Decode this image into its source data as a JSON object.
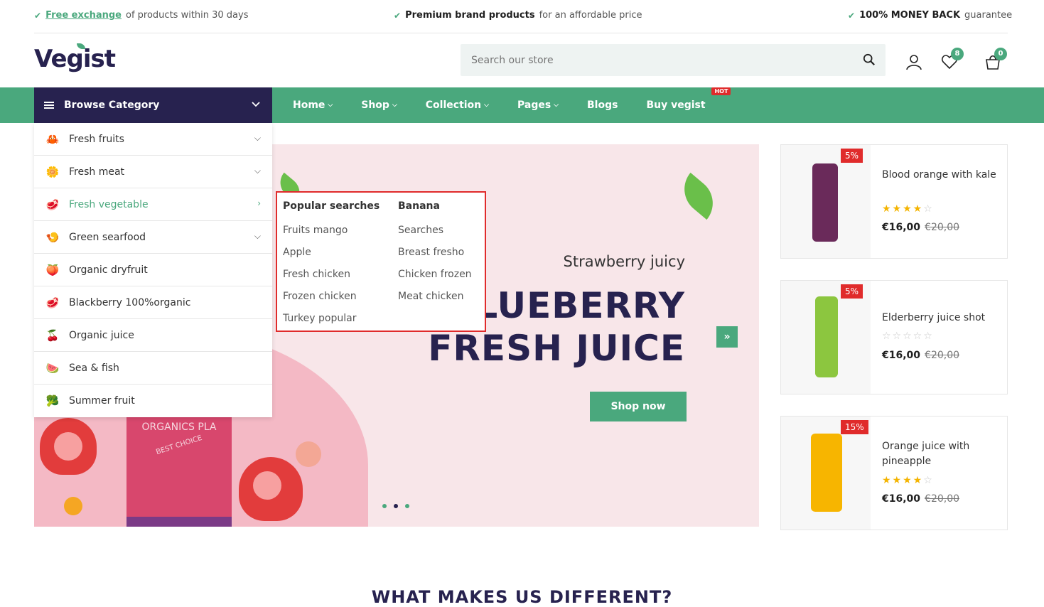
{
  "topbar": {
    "item1_link": "Free exchange",
    "item1_text": "of products within 30 days",
    "item2_bold": "Premium brand products",
    "item2_text": "for an affordable price",
    "item3_bold": "100% MONEY BACK",
    "item3_text": "guarantee",
    "check_icon": "check-icon"
  },
  "header": {
    "logo": "Vegist",
    "search_placeholder": "Search our store",
    "wishlist_count": "8",
    "cart_count": "0"
  },
  "nav": {
    "browse_label": "Browse Category",
    "items": [
      {
        "label": "Home",
        "dropdown": true
      },
      {
        "label": "Shop",
        "dropdown": true
      },
      {
        "label": "Collection",
        "dropdown": true
      },
      {
        "label": "Pages",
        "dropdown": true
      },
      {
        "label": "Blogs",
        "dropdown": false
      },
      {
        "label": "Buy vegist",
        "dropdown": false
      }
    ],
    "hot_badge": "HOT",
    "accent": "#4aa87d",
    "dark": "#27224f"
  },
  "categories": [
    {
      "label": "Fresh fruits",
      "arrow": "down"
    },
    {
      "label": "Fresh meat",
      "arrow": "down"
    },
    {
      "label": "Fresh vegetable",
      "arrow": "right"
    },
    {
      "label": "Green searfood",
      "arrow": "down"
    },
    {
      "label": "Organic dryfruit",
      "arrow": ""
    },
    {
      "label": "Blackberry 100%organic",
      "arrow": ""
    },
    {
      "label": "Organic juice",
      "arrow": ""
    },
    {
      "label": "Sea & fish",
      "arrow": ""
    },
    {
      "label": "Summer fruit",
      "arrow": ""
    }
  ],
  "popup": {
    "col1_title": "Popular searches",
    "col1_items": [
      "Fruits mango",
      "Apple",
      "Fresh chicken",
      "Frozen chicken",
      "Turkey popular"
    ],
    "col2_title": "Banana",
    "col2_items": [
      "Searches",
      "Breast fresho",
      "Chicken frozen",
      "Meat chicken"
    ]
  },
  "banner": {
    "subtitle": "Strawberry juicy",
    "heading_line1": "BLUEBERRY",
    "heading_line2": "FRESH JUICE",
    "button": "Shop now",
    "bottle_label": "ORGANICS PLA",
    "bottle_label2": "BEST CHOICE",
    "next_icon": "»"
  },
  "products": [
    {
      "discount": "5%",
      "name": "Blood orange with kale",
      "rating": 4,
      "price": "€16,00",
      "old_price": "€20,00"
    },
    {
      "discount": "5%",
      "name": "Elderberry juice shot",
      "rating": 0,
      "price": "€16,00",
      "old_price": "€20,00"
    },
    {
      "discount": "15%",
      "name": "Orange juice with pineapple",
      "rating": 4,
      "price": "€16,00",
      "old_price": "€20,00"
    }
  ],
  "section_title": "WHAT MAKES US DIFFERENT?"
}
